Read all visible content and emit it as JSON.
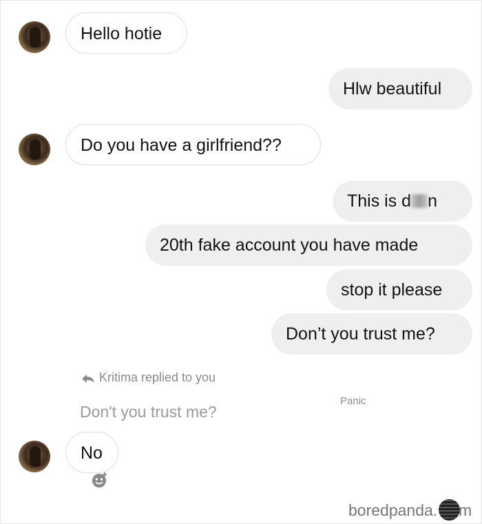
{
  "messages": [
    {
      "text": "Hello hotie"
    },
    {
      "text": "Hlw beautiful"
    },
    {
      "text": "Do you have a girlfriend??"
    },
    {
      "text_before": "This is d",
      "text_after": "n"
    },
    {
      "text": "20th fake account you have made"
    },
    {
      "text": "stop it please"
    },
    {
      "text": "Don’t you trust me?"
    },
    {
      "text": "No"
    }
  ],
  "reply": {
    "meta": "Kritima replied to you",
    "quote": "Don't you trust me?",
    "caption": "Panic"
  },
  "watermark": {
    "text": "boredpanda.",
    "tail": "m"
  }
}
